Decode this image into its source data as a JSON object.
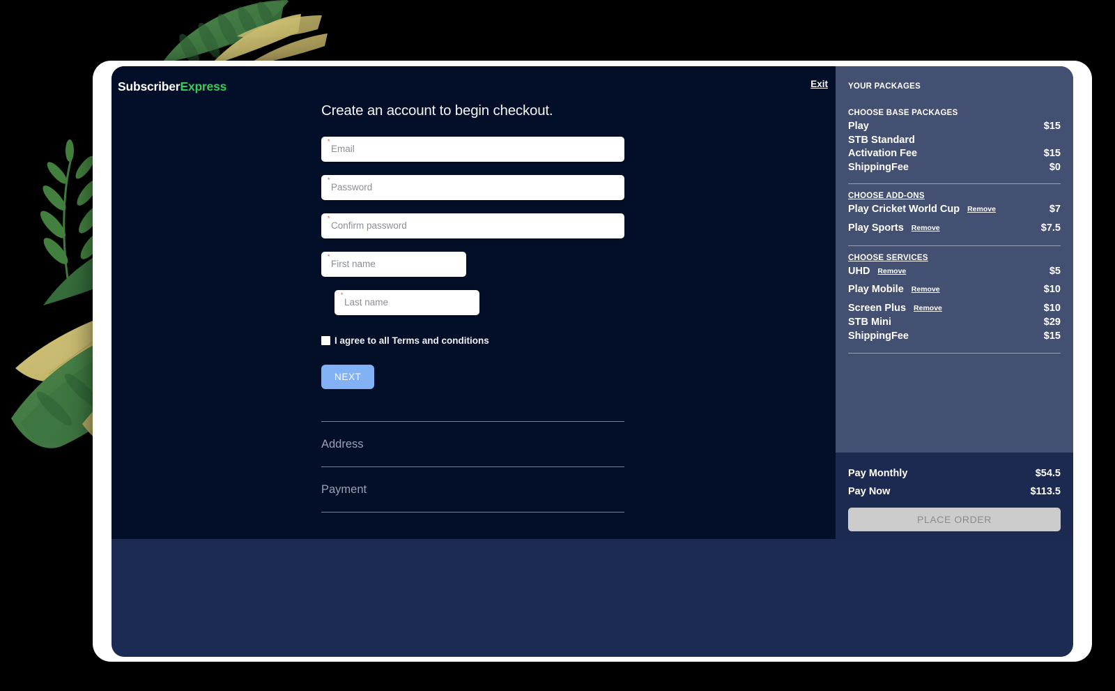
{
  "brand": {
    "part1": "Subscriber",
    "part2": "Express",
    "accent_color": "#33cc55"
  },
  "header": {
    "exit_label": "Exit"
  },
  "form": {
    "title": "Create an account to begin checkout.",
    "required_marker": "*",
    "fields": [
      {
        "name": "email",
        "placeholder": "Email",
        "value": "",
        "required": true
      },
      {
        "name": "password",
        "placeholder": "Password",
        "value": "",
        "required": true
      },
      {
        "name": "confirm_password",
        "placeholder": "Confirm password",
        "value": "",
        "required": true
      },
      {
        "name": "first_name",
        "placeholder": "First name",
        "value": "",
        "required": true
      },
      {
        "name": "last_name",
        "placeholder": "Last name",
        "value": "",
        "required": true
      }
    ],
    "terms_label": "I agree to all Terms and conditions",
    "terms_checked": false,
    "next_label": "NEXT"
  },
  "accordion": [
    {
      "label": "Address"
    },
    {
      "label": "Payment"
    }
  ],
  "sidebar": {
    "title": "YOUR PACKAGES",
    "sections": [
      {
        "heading": "CHOOSE BASE PACKAGES",
        "underlined": false,
        "items": [
          {
            "name": "Play",
            "price": "$15",
            "remove": null,
            "spaced": false
          },
          {
            "name": "STB Standard",
            "price": "",
            "remove": null,
            "spaced": false
          },
          {
            "name": "Activation Fee",
            "price": "$15",
            "remove": null,
            "spaced": false
          },
          {
            "name": "ShippingFee",
            "price": "$0",
            "remove": null,
            "spaced": false
          }
        ]
      },
      {
        "heading": "CHOOSE ADD-ONS",
        "underlined": true,
        "items": [
          {
            "name": "Play Cricket World Cup",
            "price": "$7",
            "remove": "Remove",
            "spaced": false
          },
          {
            "name": "Play Sports",
            "price": "$7.5",
            "remove": "Remove",
            "spaced": true
          }
        ]
      },
      {
        "heading": "CHOOSE SERVICES",
        "underlined": true,
        "items": [
          {
            "name": "UHD",
            "price": "$5",
            "remove": "Remove",
            "spaced": false
          },
          {
            "name": "Play Mobile",
            "price": "$10",
            "remove": "Remove",
            "spaced": true
          },
          {
            "name": "Screen Plus",
            "price": "$10",
            "remove": "Remove",
            "spaced": true
          },
          {
            "name": "STB Mini",
            "price": "$29",
            "remove": null,
            "spaced": false
          },
          {
            "name": "ShippingFee",
            "price": "$15",
            "remove": null,
            "spaced": false
          }
        ]
      }
    ],
    "totals": [
      {
        "label": "Pay Monthly",
        "amount": "$54.5"
      },
      {
        "label": "Pay Now",
        "amount": "$113.5"
      }
    ],
    "place_order_label": "PLACE ORDER"
  },
  "colors": {
    "page_background": "#000000",
    "main_pane": "#030f28",
    "sidebar": "#445072",
    "sidebar_footer": "#1c2a52",
    "screen_lower": "#1c2b54",
    "next_button": "#82b1f5",
    "place_order_button": "#cccccc",
    "required_asterisk": "#e05252"
  }
}
